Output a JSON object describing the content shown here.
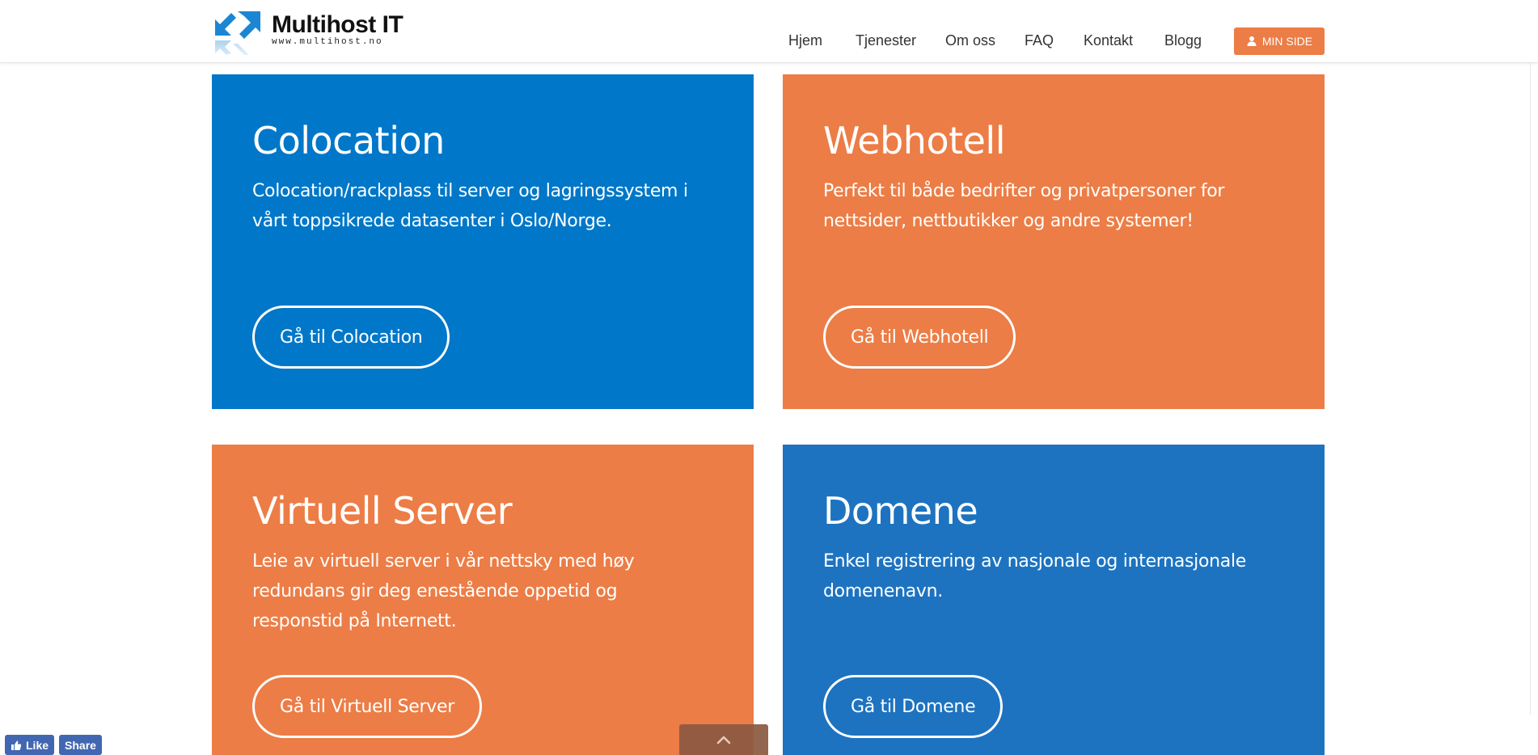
{
  "header": {
    "logo": {
      "name": "Multihost IT",
      "url": "www.multihost.no"
    },
    "nav": [
      {
        "label": "Hjem"
      },
      {
        "label": "Tjenester"
      },
      {
        "label": "Om oss"
      },
      {
        "label": "FAQ"
      },
      {
        "label": "Kontakt"
      },
      {
        "label": "Blogg"
      }
    ],
    "min_side_label": "MIN SIDE"
  },
  "cards": [
    {
      "title": "Colocation",
      "description": "Colocation/rackplass til server og lagringssystem i vårt toppsikrede datasenter i Oslo/Norge.",
      "button": "Gå til Colocation",
      "color": "#0077c8"
    },
    {
      "title": "Webhotell",
      "description": "Perfekt til både bedrifter og privatpersoner for nettsider, nettbutikker og andre systemer!",
      "button": "Gå til Webhotell",
      "color": "#ec7d46"
    },
    {
      "title": "Virtuell Server",
      "description": "Leie av virtuell server i vår nettsky med høy redundans gir deg enestående oppetid og responstid på Internett.",
      "button": "Gå til Virtuell Server",
      "color": "#ec7d46"
    },
    {
      "title": "Domene",
      "description": "Enkel registrering av nasjonale og internasjonale domenenavn.",
      "button": "Gå til Domene",
      "color": "#1d73c0"
    }
  ],
  "facebook": {
    "like_label": "Like",
    "share_label": "Share"
  },
  "icons": {
    "logo": "arrows-logo-icon",
    "user": "user-icon",
    "scroll_top": "chevron-up-icon",
    "thumb": "thumbs-up-icon"
  },
  "colors": {
    "accent_orange": "#ec7d46",
    "accent_blue": "#0077c8",
    "facebook_blue": "#4267b2"
  }
}
